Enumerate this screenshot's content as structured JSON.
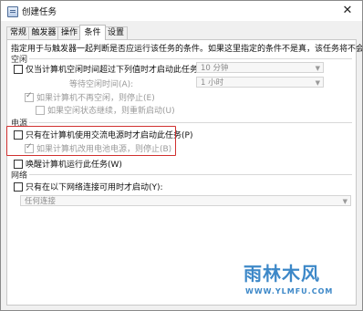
{
  "window": {
    "title": "创建任务",
    "close_glyph": "✕"
  },
  "tabs": [
    {
      "label": "常规",
      "active": false
    },
    {
      "label": "触发器",
      "active": false
    },
    {
      "label": "操作",
      "active": false
    },
    {
      "label": "条件",
      "active": true
    },
    {
      "label": "设置",
      "active": false
    }
  ],
  "description": "指定用于与触发器一起判断是否应运行该任务的条件。如果这里指定的条件不是真，该任务将不会运行。",
  "idle": {
    "section_label": "空闲",
    "start_if_idle": {
      "label": "仅当计算机空闲时间超过下列值时才启动此任务(C):",
      "checked": false
    },
    "idle_duration": {
      "value": "10 分钟"
    },
    "wait_label": "等待空闲时间(A):",
    "wait_duration": {
      "value": "1 小时"
    },
    "stop_if_not_idle": {
      "label": "如果计算机不再空闲，则停止(E)",
      "checked": true
    },
    "restart_if_idle": {
      "label": "如果空闲状态继续，则重新启动(U)",
      "checked": false
    }
  },
  "power": {
    "section_label": "电源",
    "ac_only": {
      "label": "只有在计算机使用交流电源时才启动此任务(P)",
      "checked": false
    },
    "stop_on_battery": {
      "label": "如果计算机改用电池电源，则停止(B)",
      "checked": true
    },
    "wake": {
      "label": "唤醒计算机运行此任务(W)",
      "checked": false
    }
  },
  "network": {
    "section_label": "网络",
    "only_if_network": {
      "label": "只有在以下网络连接可用时才启动(Y):",
      "checked": false
    },
    "connection": {
      "value": "任何连接"
    }
  },
  "watermark": {
    "main": "雨林木风",
    "sub": "WWW.YLMFU.COM"
  },
  "colors": {
    "highlight": "#d0302f",
    "watermark": "#3d88c8"
  }
}
